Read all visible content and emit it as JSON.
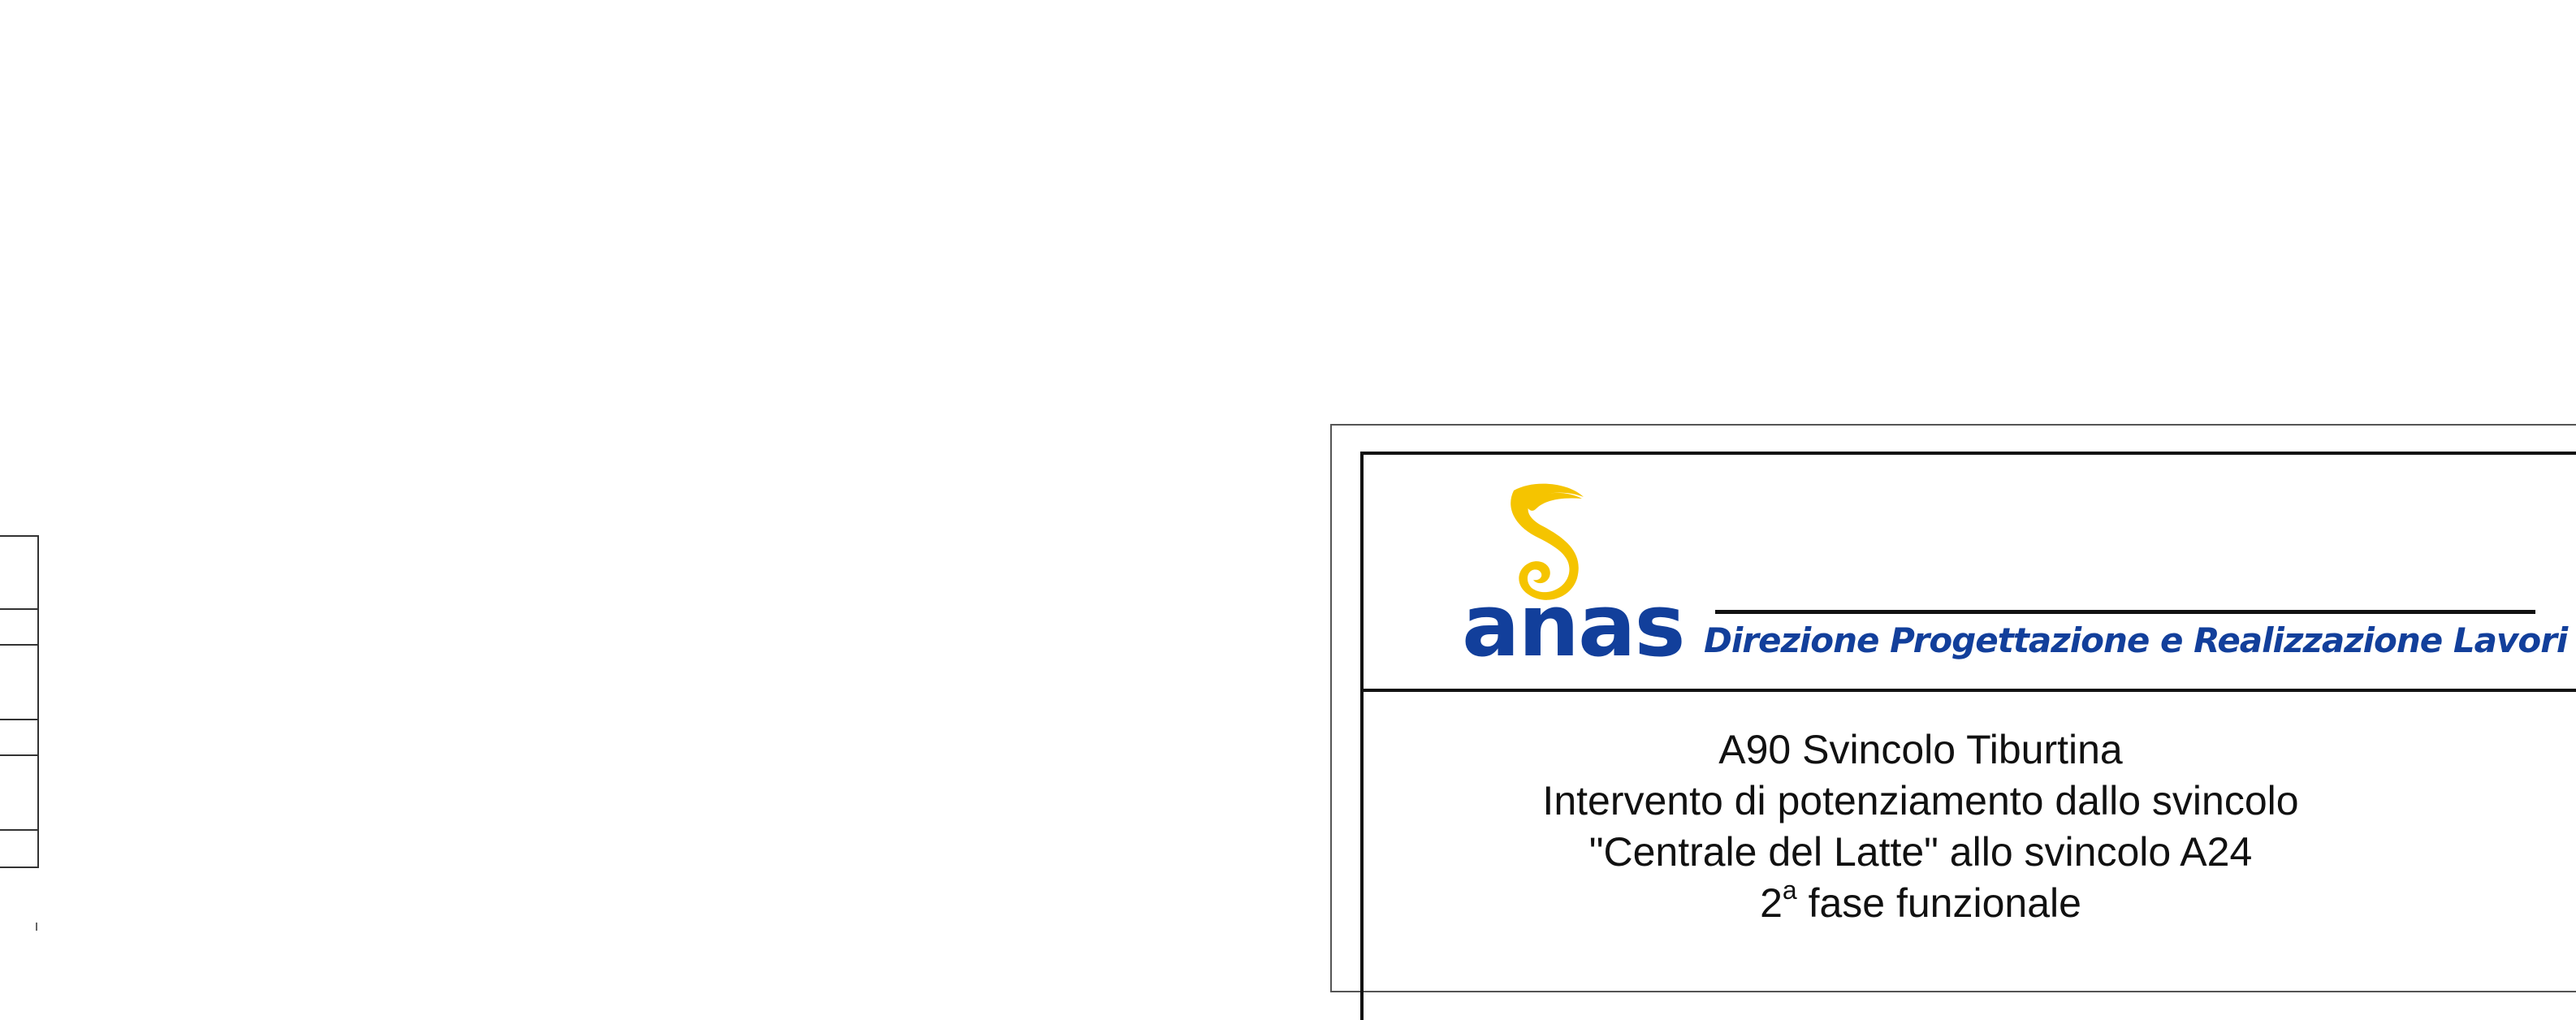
{
  "organization": {
    "logo_text": "anas",
    "department": "Direzione Progettazione e Realizzazione Lavori"
  },
  "project": {
    "line1": "A90 Svincolo Tiburtina",
    "line2": "Intervento di potenziamento dallo svincolo",
    "line3": "\"Centrale del Latte\" allo svincolo A24",
    "line4_number": "2",
    "line4_superscript": "a",
    "line4_text": " fase funzionale"
  },
  "colors": {
    "brand_blue": "#123f9b",
    "logo_yellow": "#f5c400",
    "line": "#111111"
  },
  "icons": {
    "logo": "anas-swirl-logo-icon"
  }
}
